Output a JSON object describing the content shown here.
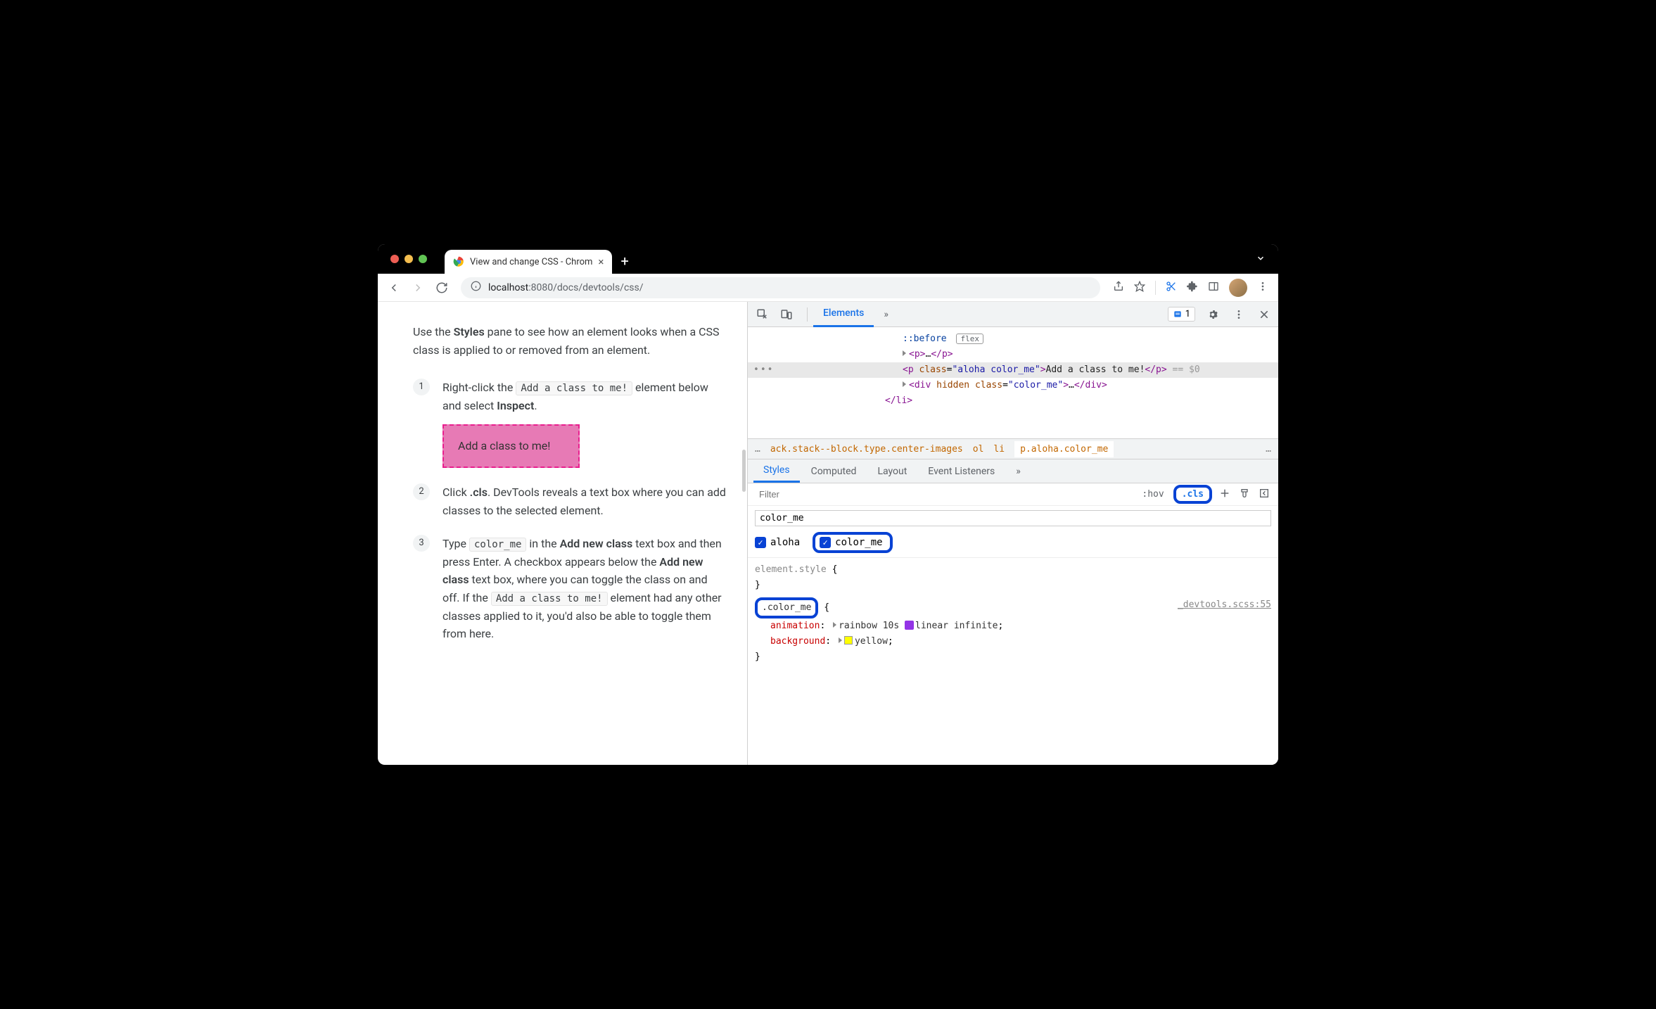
{
  "browser": {
    "tab_title": "View and change CSS - Chrom",
    "url_host": "localhost",
    "url_port": ":8080",
    "url_path": "/docs/devtools/css/"
  },
  "page": {
    "intro": {
      "pre": "Use the ",
      "bold": "Styles",
      "post": " pane to see how an element looks when a CSS class is applied to or removed from an element."
    },
    "step1": {
      "pre": "Right-click the ",
      "code": "Add a class to me!",
      "mid": " element below and select ",
      "bold": "Inspect",
      "post": "."
    },
    "demo_box": "Add a class to me!",
    "step2": {
      "pre": "Click ",
      "bold": ".cls",
      "post": ". DevTools reveals a text box where you can add classes to the selected element."
    },
    "step3": {
      "pre": "Type ",
      "code1": "color_me",
      "mid1": " in the ",
      "bold1": "Add new class",
      "mid2": " text box and then press Enter. A checkbox appears below the ",
      "bold2": "Add new class",
      "mid3": " text box, where you can toggle the class on and off. If the ",
      "code2": "Add a class to me!",
      "post": " element had any other classes applied to it, you'd also be able to toggle them from here."
    }
  },
  "devtools": {
    "tabs": {
      "elements": "Elements",
      "more": "»"
    },
    "issues_count": "1",
    "dom": {
      "before": "::before",
      "flex_badge": "flex",
      "p_collapsed": "<p>…</p>",
      "selected_open": "<p class=\"aloha color_me\">",
      "selected_text": "Add a class to me!",
      "selected_close": "</p>",
      "dollar": " == $0",
      "div_open": "<div hidden class=\"color_me\">",
      "div_mid": "…",
      "div_close": "</div>",
      "li_close": "</li>"
    },
    "breadcrumb": {
      "ellipsis": "…",
      "item1": "ack.stack--block.type.center-images",
      "item2": "ol",
      "item3": "li",
      "item4": "p.aloha.color_me",
      "end": "…"
    },
    "styles_tabs": {
      "styles": "Styles",
      "computed": "Computed",
      "layout": "Layout",
      "event_listeners": "Event Listeners",
      "more": "»"
    },
    "filter_placeholder": "Filter",
    "hov": ":hov",
    "cls": ".cls",
    "add_class_value": "color_me",
    "checks": {
      "aloha": "aloha",
      "color_me": "color_me"
    },
    "rules": {
      "element_style": "element.style",
      "color_me_selector": ".color_me",
      "source": "_devtools.scss:55",
      "prop1_name": "animation",
      "prop1_val_pre": "rainbow 10s ",
      "prop1_val_post": "linear infinite",
      "prop2_name": "background",
      "prop2_val": "yellow",
      "yellow_color": "#ffff00"
    }
  }
}
